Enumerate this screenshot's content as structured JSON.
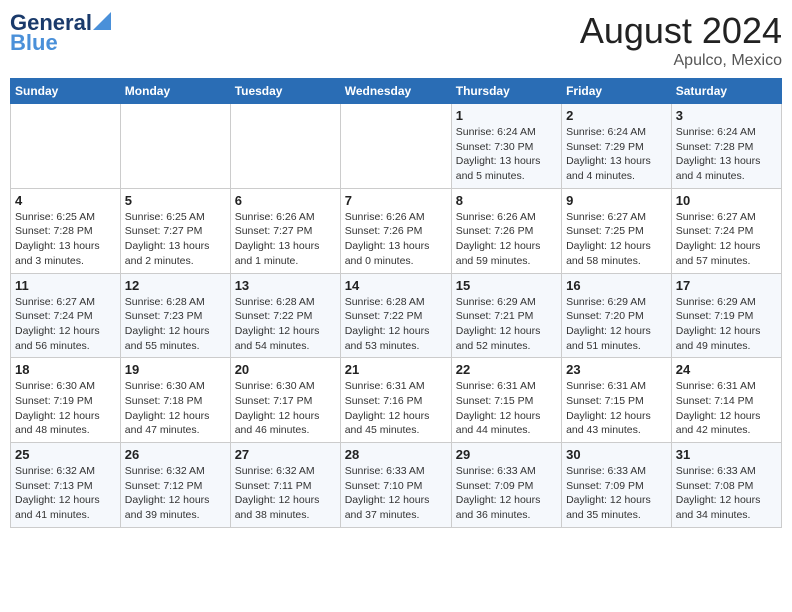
{
  "header": {
    "logo_general": "General",
    "logo_blue": "Blue",
    "month_year": "August 2024",
    "location": "Apulco, Mexico"
  },
  "days_of_week": [
    "Sunday",
    "Monday",
    "Tuesday",
    "Wednesday",
    "Thursday",
    "Friday",
    "Saturday"
  ],
  "weeks": [
    [
      {
        "day": "",
        "info": ""
      },
      {
        "day": "",
        "info": ""
      },
      {
        "day": "",
        "info": ""
      },
      {
        "day": "",
        "info": ""
      },
      {
        "day": "1",
        "info": "Sunrise: 6:24 AM\nSunset: 7:30 PM\nDaylight: 13 hours\nand 5 minutes."
      },
      {
        "day": "2",
        "info": "Sunrise: 6:24 AM\nSunset: 7:29 PM\nDaylight: 13 hours\nand 4 minutes."
      },
      {
        "day": "3",
        "info": "Sunrise: 6:24 AM\nSunset: 7:28 PM\nDaylight: 13 hours\nand 4 minutes."
      }
    ],
    [
      {
        "day": "4",
        "info": "Sunrise: 6:25 AM\nSunset: 7:28 PM\nDaylight: 13 hours\nand 3 minutes."
      },
      {
        "day": "5",
        "info": "Sunrise: 6:25 AM\nSunset: 7:27 PM\nDaylight: 13 hours\nand 2 minutes."
      },
      {
        "day": "6",
        "info": "Sunrise: 6:26 AM\nSunset: 7:27 PM\nDaylight: 13 hours\nand 1 minute."
      },
      {
        "day": "7",
        "info": "Sunrise: 6:26 AM\nSunset: 7:26 PM\nDaylight: 13 hours\nand 0 minutes."
      },
      {
        "day": "8",
        "info": "Sunrise: 6:26 AM\nSunset: 7:26 PM\nDaylight: 12 hours\nand 59 minutes."
      },
      {
        "day": "9",
        "info": "Sunrise: 6:27 AM\nSunset: 7:25 PM\nDaylight: 12 hours\nand 58 minutes."
      },
      {
        "day": "10",
        "info": "Sunrise: 6:27 AM\nSunset: 7:24 PM\nDaylight: 12 hours\nand 57 minutes."
      }
    ],
    [
      {
        "day": "11",
        "info": "Sunrise: 6:27 AM\nSunset: 7:24 PM\nDaylight: 12 hours\nand 56 minutes."
      },
      {
        "day": "12",
        "info": "Sunrise: 6:28 AM\nSunset: 7:23 PM\nDaylight: 12 hours\nand 55 minutes."
      },
      {
        "day": "13",
        "info": "Sunrise: 6:28 AM\nSunset: 7:22 PM\nDaylight: 12 hours\nand 54 minutes."
      },
      {
        "day": "14",
        "info": "Sunrise: 6:28 AM\nSunset: 7:22 PM\nDaylight: 12 hours\nand 53 minutes."
      },
      {
        "day": "15",
        "info": "Sunrise: 6:29 AM\nSunset: 7:21 PM\nDaylight: 12 hours\nand 52 minutes."
      },
      {
        "day": "16",
        "info": "Sunrise: 6:29 AM\nSunset: 7:20 PM\nDaylight: 12 hours\nand 51 minutes."
      },
      {
        "day": "17",
        "info": "Sunrise: 6:29 AM\nSunset: 7:19 PM\nDaylight: 12 hours\nand 49 minutes."
      }
    ],
    [
      {
        "day": "18",
        "info": "Sunrise: 6:30 AM\nSunset: 7:19 PM\nDaylight: 12 hours\nand 48 minutes."
      },
      {
        "day": "19",
        "info": "Sunrise: 6:30 AM\nSunset: 7:18 PM\nDaylight: 12 hours\nand 47 minutes."
      },
      {
        "day": "20",
        "info": "Sunrise: 6:30 AM\nSunset: 7:17 PM\nDaylight: 12 hours\nand 46 minutes."
      },
      {
        "day": "21",
        "info": "Sunrise: 6:31 AM\nSunset: 7:16 PM\nDaylight: 12 hours\nand 45 minutes."
      },
      {
        "day": "22",
        "info": "Sunrise: 6:31 AM\nSunset: 7:15 PM\nDaylight: 12 hours\nand 44 minutes."
      },
      {
        "day": "23",
        "info": "Sunrise: 6:31 AM\nSunset: 7:15 PM\nDaylight: 12 hours\nand 43 minutes."
      },
      {
        "day": "24",
        "info": "Sunrise: 6:31 AM\nSunset: 7:14 PM\nDaylight: 12 hours\nand 42 minutes."
      }
    ],
    [
      {
        "day": "25",
        "info": "Sunrise: 6:32 AM\nSunset: 7:13 PM\nDaylight: 12 hours\nand 41 minutes."
      },
      {
        "day": "26",
        "info": "Sunrise: 6:32 AM\nSunset: 7:12 PM\nDaylight: 12 hours\nand 39 minutes."
      },
      {
        "day": "27",
        "info": "Sunrise: 6:32 AM\nSunset: 7:11 PM\nDaylight: 12 hours\nand 38 minutes."
      },
      {
        "day": "28",
        "info": "Sunrise: 6:33 AM\nSunset: 7:10 PM\nDaylight: 12 hours\nand 37 minutes."
      },
      {
        "day": "29",
        "info": "Sunrise: 6:33 AM\nSunset: 7:09 PM\nDaylight: 12 hours\nand 36 minutes."
      },
      {
        "day": "30",
        "info": "Sunrise: 6:33 AM\nSunset: 7:09 PM\nDaylight: 12 hours\nand 35 minutes."
      },
      {
        "day": "31",
        "info": "Sunrise: 6:33 AM\nSunset: 7:08 PM\nDaylight: 12 hours\nand 34 minutes."
      }
    ]
  ]
}
